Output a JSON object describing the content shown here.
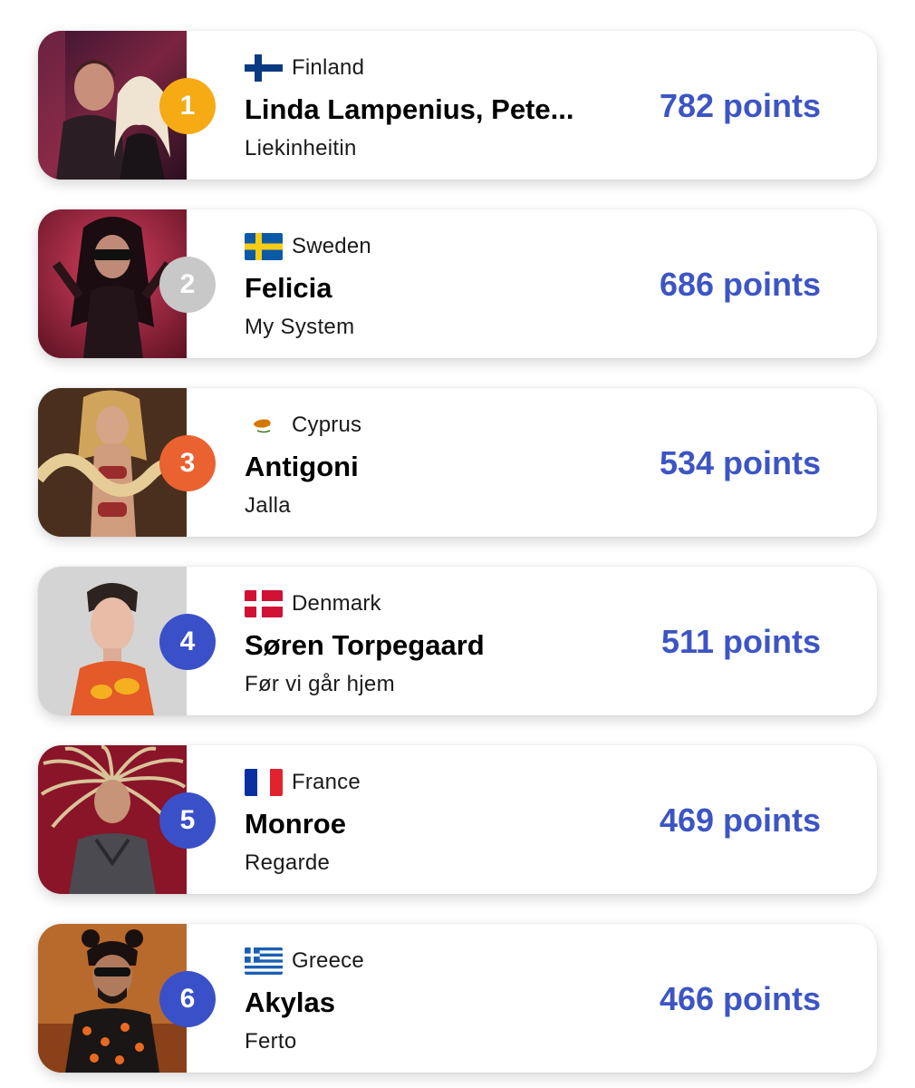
{
  "entries": [
    {
      "rank": "1",
      "country": "Finland",
      "artist": "Linda Lampenius, Pete...",
      "song": "Liekinheitin",
      "points": "782 points",
      "badge_color": "#f6aa14",
      "flag": "finland-flag-icon",
      "photo": "artist-photo"
    },
    {
      "rank": "2",
      "country": "Sweden",
      "artist": "Felicia",
      "song": "My System",
      "points": "686 points",
      "badge_color": "#c8c8c8",
      "flag": "sweden-flag-icon",
      "photo": "artist-photo"
    },
    {
      "rank": "3",
      "country": "Cyprus",
      "artist": "Antigoni",
      "song": "Jalla",
      "points": "534 points",
      "badge_color": "#e9622f",
      "flag": "cyprus-flag-icon",
      "photo": "artist-photo"
    },
    {
      "rank": "4",
      "country": "Denmark",
      "artist": "Søren Torpegaard",
      "song": "Før vi går hjem",
      "points": "511 points",
      "badge_color": "#3a50c8",
      "flag": "denmark-flag-icon",
      "photo": "artist-photo"
    },
    {
      "rank": "5",
      "country": "France",
      "artist": "Monroe",
      "song": "Regarde",
      "points": "469 points",
      "badge_color": "#3a50c8",
      "flag": "france-flag-icon",
      "photo": "artist-photo"
    },
    {
      "rank": "6",
      "country": "Greece",
      "artist": "Akylas",
      "song": "Ferto",
      "points": "466 points",
      "badge_color": "#3a50c8",
      "flag": "greece-flag-icon",
      "photo": "artist-photo"
    }
  ],
  "colors": {
    "points": "#3d55c4",
    "text": "#000000"
  }
}
